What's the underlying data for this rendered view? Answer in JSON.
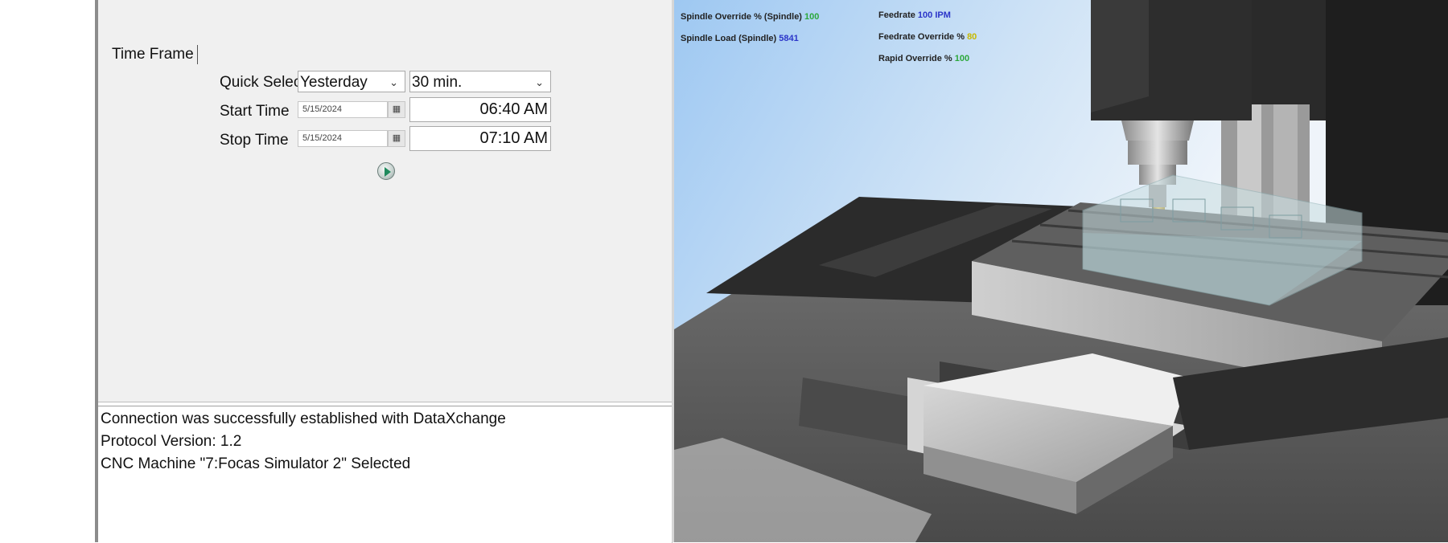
{
  "time_frame": {
    "title": "Time Frame",
    "quick_select_label": "Quick Select",
    "quick_select_value": "Yesterday",
    "duration_value": "30 min.",
    "start_label": "Start Time",
    "start_date": "5/15/2024",
    "start_time": "06:40 AM",
    "stop_label": "Stop Time",
    "stop_date": "5/15/2024",
    "stop_time": "07:10 AM"
  },
  "log": {
    "lines": [
      "Connection was successfully established with DataXchange",
      "Protocol Version: 1.2",
      "CNC Machine \"7:Focas Simulator 2\" Selected"
    ]
  },
  "readouts": {
    "spindle_override_label": "Spindle Override % (Spindle)",
    "spindle_override_value": "100",
    "spindle_load_label": "Spindle Load (Spindle)",
    "spindle_load_value": "5841",
    "feedrate_label": "Feedrate",
    "feedrate_value": "100 IPM",
    "feedrate_override_label": "Feedrate Override %",
    "feedrate_override_value": "80",
    "rapid_override_label": "Rapid Override %",
    "rapid_override_value": "100"
  },
  "icons": {
    "calendar": "calendar-icon",
    "dropdown": "chevron-down-icon",
    "run": "play-icon"
  },
  "colors": {
    "value_green": "#2ca83b",
    "value_blue": "#2b35c9",
    "value_yellow": "#c7b800"
  }
}
